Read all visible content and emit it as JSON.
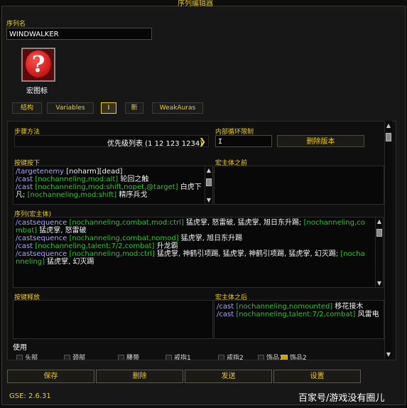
{
  "window_title": "序列编辑器",
  "sequence_name": {
    "label": "序列名",
    "value": "WINDWALKER"
  },
  "macro_icon": {
    "label": "宏图标",
    "glyph": "?"
  },
  "tabs": [
    {
      "label": "结构",
      "active": false
    },
    {
      "label": "Variables",
      "active": false
    },
    {
      "label": "I",
      "active": true
    },
    {
      "label": "新",
      "active": false
    },
    {
      "label": "WeakAuras",
      "active": false
    }
  ],
  "step_function": {
    "label": "步骤方法",
    "value": "优先级列表 (1 12 123 1234)"
  },
  "inner_loop": {
    "label": "内部循环限制",
    "value": "I"
  },
  "delete_version_button": "删除版本",
  "keypress": {
    "label": "按键按下",
    "lines": [
      [
        {
          "t": "cmd",
          "v": "/targetenemy "
        },
        {
          "t": "spell",
          "v": "[noharm][dead]"
        }
      ],
      [
        {
          "t": "cmd",
          "v": "/cast "
        },
        {
          "t": "cond",
          "v": "[nochanneling,mod:alt] "
        },
        {
          "t": "spell",
          "v": "轮回之触"
        }
      ],
      [
        {
          "t": "cmd",
          "v": "/cast "
        },
        {
          "t": "cond",
          "v": "[nochanneling,mod:shift,nopet,@target] "
        },
        {
          "t": "spell",
          "v": "白虎下凡; "
        },
        {
          "t": "cond",
          "v": "[nochanneling,mod:shift] "
        },
        {
          "t": "spell",
          "v": "精序兵戈"
        }
      ]
    ]
  },
  "premacro": {
    "label": "宏主体之前"
  },
  "sequence_body": {
    "label": "序列(宏主体)",
    "lines": [
      [
        {
          "t": "cmd",
          "v": "/castsequence "
        },
        {
          "t": "cond",
          "v": "[nochanneling,combat,mod:ctrl] "
        },
        {
          "t": "spell",
          "v": "猛虎掌, 怒雷破, 猛虎掌, 旭日东升踢; "
        },
        {
          "t": "cond",
          "v": "[nochanneling,combat] "
        },
        {
          "t": "spell",
          "v": "猛虎掌, 怒雷破"
        }
      ],
      [
        {
          "t": "cmd",
          "v": "/castsequence "
        },
        {
          "t": "cond",
          "v": "[nochanneling,combat,nomod] "
        },
        {
          "t": "spell",
          "v": "猛虎掌, 旭日东升踢"
        }
      ],
      [
        {
          "t": "cmd",
          "v": "/cast "
        },
        {
          "t": "cond",
          "v": "[nochanneling,talent:7/2,combat] "
        },
        {
          "t": "spell",
          "v": "升龙霸"
        }
      ],
      [
        {
          "t": "cmd",
          "v": "/castsequence "
        },
        {
          "t": "cond",
          "v": "[nochanneling,mod:ctrl] "
        },
        {
          "t": "spell",
          "v": "猛虎掌, 神鹤引项踢, 猛虎掌, 神鹤引项踢, 猛虎掌, 幻灭踢; "
        },
        {
          "t": "cond",
          "v": "[nochanneling] "
        },
        {
          "t": "spell",
          "v": "猛虎掌, 幻灭踢"
        }
      ]
    ]
  },
  "keyrelease": {
    "label": "按键释放"
  },
  "postmacro": {
    "label": "宏主体之后",
    "lines": [
      [
        {
          "t": "cmd",
          "v": "/cast "
        },
        {
          "t": "cond",
          "v": "[nochanneling,nomounted] "
        },
        {
          "t": "spell",
          "v": "移花接木"
        }
      ],
      [
        {
          "t": "cmd",
          "v": "/cast "
        },
        {
          "t": "cond",
          "v": "[nochanneling,talent:7/2,combat] "
        },
        {
          "t": "spell",
          "v": "风雷电"
        }
      ]
    ]
  },
  "use": {
    "label": "使用",
    "items": [
      {
        "label": "头部",
        "checked": false
      },
      {
        "label": "颈部",
        "checked": false
      },
      {
        "label": "腰带",
        "checked": false
      },
      {
        "label": "戒指1",
        "checked": false
      },
      {
        "label": "戒指2",
        "checked": false
      },
      {
        "label": "饰品1",
        "checked": false
      },
      {
        "label": "饰品2",
        "checked": true
      }
    ]
  },
  "buttons": {
    "save": "保存",
    "delete": "删除",
    "send": "发送",
    "settings": "设置"
  },
  "version": "GSE: 2.6.31",
  "watermark": "百家号/游戏没有圈儿"
}
